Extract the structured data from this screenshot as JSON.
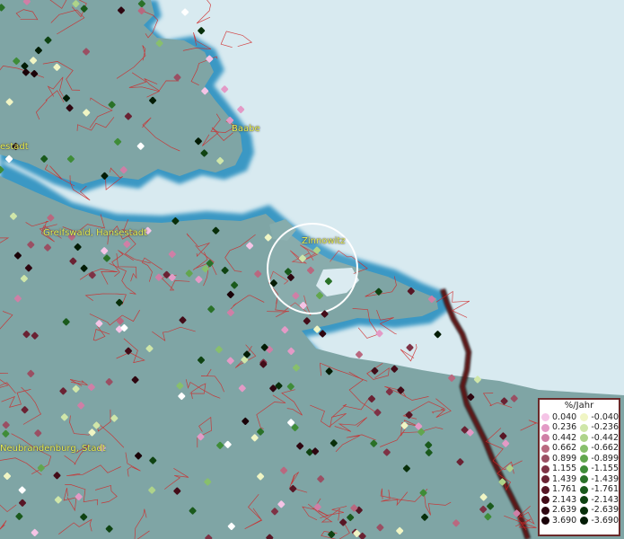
{
  "places": [
    {
      "name": "Baabe"
    },
    {
      "name": "estadt"
    },
    {
      "name": "Greifswald, Hansestadt"
    },
    {
      "name": "Zinnowitz"
    },
    {
      "name": "Neubrandenburg, Stadt"
    }
  ],
  "legend": {
    "title": "%/Jahr",
    "positive": [
      {
        "value": "0.040",
        "color": "#f5c4e6"
      },
      {
        "value": "0.236",
        "color": "#e39ac6"
      },
      {
        "value": "0.442",
        "color": "#cf7fa6"
      },
      {
        "value": "0.662",
        "color": "#b9687f"
      },
      {
        "value": "0.899",
        "color": "#9a4f63"
      },
      {
        "value": "1.155",
        "color": "#7e3245"
      },
      {
        "value": "1.439",
        "color": "#6a2233"
      },
      {
        "value": "1.761",
        "color": "#571625"
      },
      {
        "value": "2.143",
        "color": "#430c18"
      },
      {
        "value": "2.639",
        "color": "#2e0610"
      },
      {
        "value": "3.690",
        "color": "#1a0208"
      }
    ],
    "negative": [
      {
        "value": "-0.040",
        "color": "#f0f5c4"
      },
      {
        "value": "-0.236",
        "color": "#cfe6a9"
      },
      {
        "value": "-0.442",
        "color": "#aed38a"
      },
      {
        "value": "-0.662",
        "color": "#88bf6c"
      },
      {
        "value": "-0.899",
        "color": "#62a64e"
      },
      {
        "value": "-1.155",
        "color": "#3f8c38"
      },
      {
        "value": "-1.439",
        "color": "#2a7128"
      },
      {
        "value": "-1.761",
        "color": "#1a5a1c"
      },
      {
        "value": "-2.143",
        "color": "#0f4312"
      },
      {
        "value": "-2.639",
        "color": "#082f0a"
      },
      {
        "value": "-3.690",
        "color": "#031c05"
      }
    ]
  },
  "colors": {
    "sea": "#d8eaf0",
    "land": "#7fa5a5",
    "shore": "#3b98c4",
    "border": "#d02828",
    "highlight-circle": "#ffffff"
  }
}
